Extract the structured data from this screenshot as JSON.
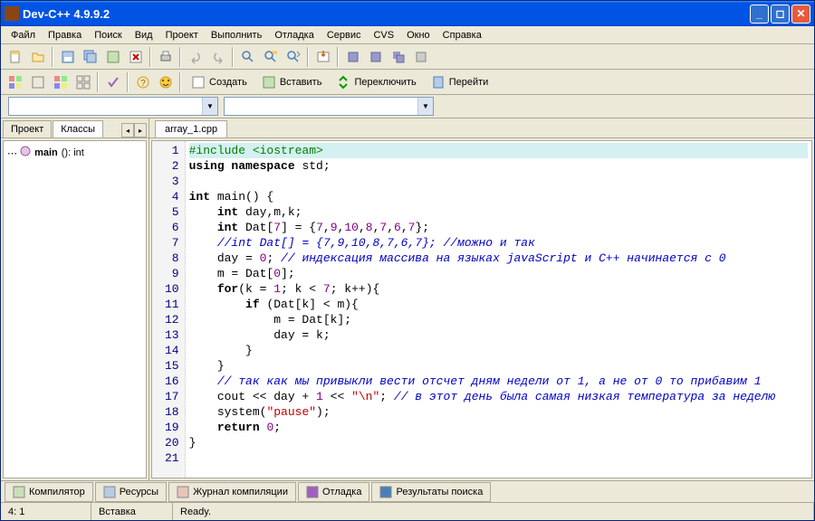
{
  "title": "Dev-C++ 4.9.9.2",
  "menu": [
    "Файл",
    "Правка",
    "Поиск",
    "Вид",
    "Проект",
    "Выполнить",
    "Отладка",
    "Сервис",
    "CVS",
    "Окно",
    "Справка"
  ],
  "toolbar2": {
    "create": "Создать",
    "insert": "Вставить",
    "switch": "Переключить",
    "goto": "Перейти"
  },
  "sidebar": {
    "tabs": [
      "Проект",
      "Классы"
    ],
    "tree_item": "main (): int"
  },
  "editor": {
    "tab": "array_1.cpp",
    "lines": [
      {
        "n": 1,
        "hl": true,
        "seg": [
          {
            "t": "#include <iostream>",
            "c": "pp"
          }
        ]
      },
      {
        "n": 2,
        "seg": [
          {
            "t": "using namespace",
            "c": "kw"
          },
          {
            "t": " std;"
          }
        ]
      },
      {
        "n": 3,
        "seg": []
      },
      {
        "n": 4,
        "seg": [
          {
            "t": "int",
            "c": "kw"
          },
          {
            "t": " main() {"
          }
        ]
      },
      {
        "n": 5,
        "seg": [
          {
            "t": "    "
          },
          {
            "t": "int",
            "c": "kw"
          },
          {
            "t": " day,m,k;"
          }
        ]
      },
      {
        "n": 6,
        "seg": [
          {
            "t": "    "
          },
          {
            "t": "int",
            "c": "kw"
          },
          {
            "t": " Dat["
          },
          {
            "t": "7",
            "c": "num"
          },
          {
            "t": "] = {"
          },
          {
            "t": "7",
            "c": "num"
          },
          {
            "t": ","
          },
          {
            "t": "9",
            "c": "num"
          },
          {
            "t": ","
          },
          {
            "t": "10",
            "c": "num"
          },
          {
            "t": ","
          },
          {
            "t": "8",
            "c": "num"
          },
          {
            "t": ","
          },
          {
            "t": "7",
            "c": "num"
          },
          {
            "t": ","
          },
          {
            "t": "6",
            "c": "num"
          },
          {
            "t": ","
          },
          {
            "t": "7",
            "c": "num"
          },
          {
            "t": "};"
          }
        ]
      },
      {
        "n": 7,
        "seg": [
          {
            "t": "    "
          },
          {
            "t": "//int Dat[] = {7,9,10,8,7,6,7}; //можно и так",
            "c": "cm"
          }
        ]
      },
      {
        "n": 8,
        "seg": [
          {
            "t": "    day = "
          },
          {
            "t": "0",
            "c": "num"
          },
          {
            "t": "; "
          },
          {
            "t": "// индексация массива на языках javaScript и С++ начинается с 0",
            "c": "cm"
          }
        ]
      },
      {
        "n": 9,
        "seg": [
          {
            "t": "    m = Dat["
          },
          {
            "t": "0",
            "c": "num"
          },
          {
            "t": "];"
          }
        ]
      },
      {
        "n": 10,
        "seg": [
          {
            "t": "    "
          },
          {
            "t": "for",
            "c": "kw"
          },
          {
            "t": "(k = "
          },
          {
            "t": "1",
            "c": "num"
          },
          {
            "t": "; k < "
          },
          {
            "t": "7",
            "c": "num"
          },
          {
            "t": "; k++){"
          }
        ]
      },
      {
        "n": 11,
        "seg": [
          {
            "t": "        "
          },
          {
            "t": "if",
            "c": "kw"
          },
          {
            "t": " (Dat[k] < m){"
          }
        ]
      },
      {
        "n": 12,
        "seg": [
          {
            "t": "            m = Dat[k];"
          }
        ]
      },
      {
        "n": 13,
        "seg": [
          {
            "t": "            day = k;"
          }
        ]
      },
      {
        "n": 14,
        "seg": [
          {
            "t": "        }"
          }
        ]
      },
      {
        "n": 15,
        "seg": [
          {
            "t": "    }"
          }
        ]
      },
      {
        "n": 16,
        "seg": [
          {
            "t": "    "
          },
          {
            "t": "// так как мы привыкли вести отсчет дням недели от 1, а не от 0 то прибавим 1",
            "c": "cm"
          }
        ]
      },
      {
        "n": 17,
        "seg": [
          {
            "t": "    cout << day + "
          },
          {
            "t": "1",
            "c": "num"
          },
          {
            "t": " << "
          },
          {
            "t": "\"\\n\"",
            "c": "str"
          },
          {
            "t": "; "
          },
          {
            "t": "// в этот день была самая низкая температура за неделю",
            "c": "cm"
          }
        ]
      },
      {
        "n": 18,
        "seg": [
          {
            "t": "    system("
          },
          {
            "t": "\"pause\"",
            "c": "str"
          },
          {
            "t": ");"
          }
        ]
      },
      {
        "n": 19,
        "seg": [
          {
            "t": "    "
          },
          {
            "t": "return",
            "c": "kw"
          },
          {
            "t": " "
          },
          {
            "t": "0",
            "c": "num"
          },
          {
            "t": ";"
          }
        ]
      },
      {
        "n": 20,
        "seg": [
          {
            "t": "}"
          }
        ]
      },
      {
        "n": 21,
        "seg": []
      }
    ]
  },
  "bottom_tabs": [
    "Компилятор",
    "Ресурсы",
    "Журнал компиляции",
    "Отладка",
    "Результаты поиска"
  ],
  "status": {
    "pos": "4: 1",
    "mode": "Вставка",
    "state": "Ready."
  }
}
